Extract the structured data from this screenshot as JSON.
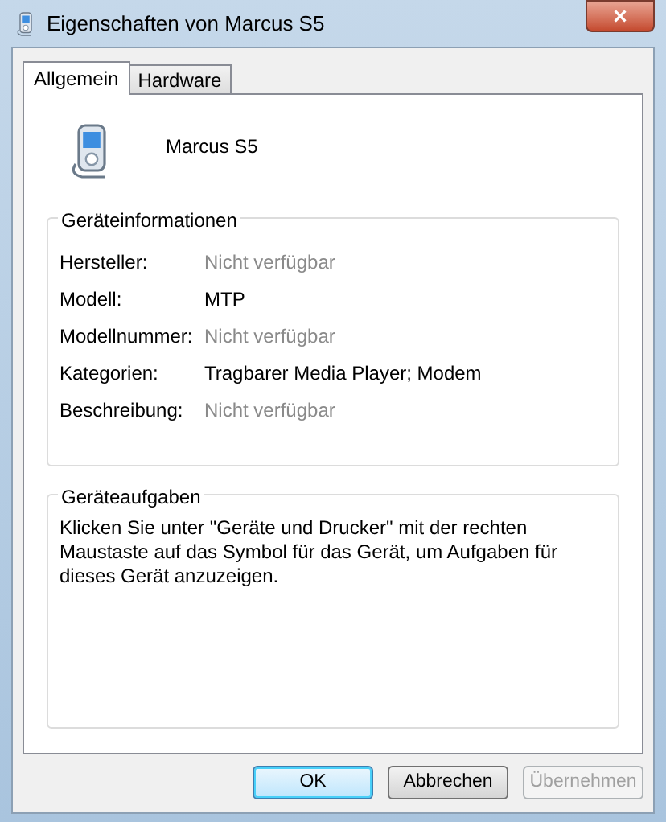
{
  "window": {
    "title": "Eigenschaften von Marcus S5",
    "close_label": "×"
  },
  "tabs": [
    {
      "label": "Allgemein",
      "selected": true
    },
    {
      "label": "Hardware",
      "selected": false
    }
  ],
  "device": {
    "name": "Marcus S5"
  },
  "info_group": {
    "title": "Geräteinformationen",
    "rows": [
      {
        "label": "Hersteller:",
        "value": "Nicht verfügbar",
        "available": false
      },
      {
        "label": "Modell:",
        "value": "MTP",
        "available": true
      },
      {
        "label": "Modellnummer:",
        "value": "Nicht verfügbar",
        "available": false
      },
      {
        "label": "Kategorien:",
        "value": "Tragbarer Media Player; Modem",
        "available": true
      },
      {
        "label": "Beschreibung:",
        "value": "Nicht verfügbar",
        "available": false
      }
    ]
  },
  "tasks_group": {
    "title": "Geräteaufgaben",
    "text": "Klicken Sie unter \"Geräte und Drucker\" mit der rechten Maustaste auf das Symbol für das Gerät, um Aufgaben für dieses Gerät anzuzeigen."
  },
  "buttons": [
    {
      "label": "OK",
      "default": true,
      "disabled": false
    },
    {
      "label": "Abbrechen",
      "default": false,
      "disabled": false
    },
    {
      "label": "Übernehmen",
      "default": false,
      "disabled": true
    }
  ]
}
